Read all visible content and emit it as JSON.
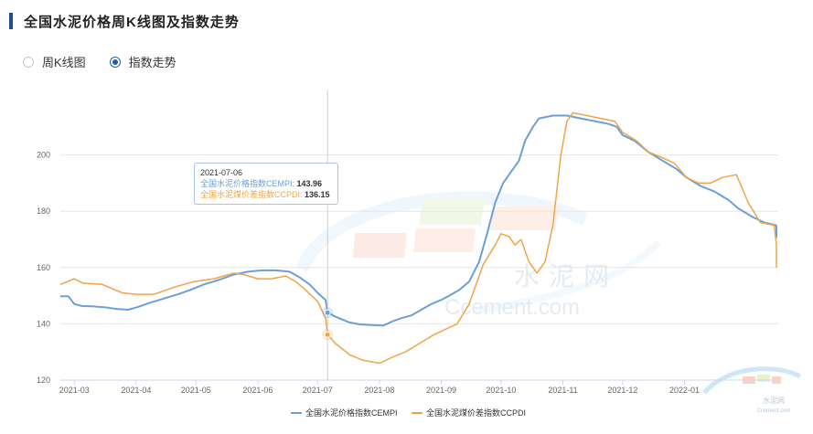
{
  "title": "全国水泥价格周K线图及指数走势",
  "tabs": [
    {
      "label": "周K线图",
      "selected": false
    },
    {
      "label": "指数走势",
      "selected": true
    }
  ],
  "colors": {
    "accent": "#1f4e8c",
    "cempi": "#6d9fd6",
    "ccpdi": "#f0a448"
  },
  "watermark": {
    "logo": "水泥网",
    "domain": "Ccement.com",
    "corner": "水泥网",
    "corner_domain": "Ccement.com"
  },
  "tooltip": {
    "date": "2021-07-06",
    "cempi_label": "全国水泥价格指数CEMPI:",
    "cempi_value": "143.96",
    "ccpdi_label": "全国水泥煤价差指数CCPDI:",
    "ccpdi_value": "136.15"
  },
  "chart_data": {
    "type": "line",
    "xlim": [
      "2021-02-22",
      "2022-02-17"
    ],
    "ylim": [
      120,
      220
    ],
    "yticks": [
      120,
      140,
      160,
      180,
      200
    ],
    "xticks": [
      "2021-03",
      "2021-04",
      "2021-05",
      "2021-06",
      "2021-07",
      "2021-08",
      "2021-09",
      "2021-10",
      "2021-11",
      "2021-12",
      "2022-01"
    ],
    "grid": "horizontal",
    "legend": "bottom-center",
    "highlight_date": "2021-07-06",
    "series": [
      {
        "name": "全国水泥价格指数CEMPI",
        "points": [
          [
            "2021-02-22",
            149.8
          ],
          [
            "2021-02-26",
            149.8
          ],
          [
            "2021-03-01",
            147
          ],
          [
            "2021-03-05",
            146.3
          ],
          [
            "2021-03-10",
            146.2
          ],
          [
            "2021-03-17",
            145.8
          ],
          [
            "2021-03-22",
            145.3
          ],
          [
            "2021-03-28",
            145
          ],
          [
            "2021-04-02",
            146
          ],
          [
            "2021-04-08",
            147.5
          ],
          [
            "2021-04-15",
            149
          ],
          [
            "2021-04-22",
            150.5
          ],
          [
            "2021-04-28",
            152
          ],
          [
            "2021-05-05",
            154
          ],
          [
            "2021-05-12",
            155.5
          ],
          [
            "2021-05-20",
            157.5
          ],
          [
            "2021-05-27",
            158.5
          ],
          [
            "2021-06-03",
            159
          ],
          [
            "2021-06-10",
            159
          ],
          [
            "2021-06-17",
            158.5
          ],
          [
            "2021-06-22",
            156.5
          ],
          [
            "2021-06-27",
            154
          ],
          [
            "2021-07-01",
            151
          ],
          [
            "2021-07-05",
            148.5
          ],
          [
            "2021-07-06",
            143.96
          ],
          [
            "2021-07-10",
            142.5
          ],
          [
            "2021-07-17",
            140.5
          ],
          [
            "2021-07-22",
            139.8
          ],
          [
            "2021-07-29",
            139.5
          ],
          [
            "2021-08-03",
            139.4
          ],
          [
            "2021-08-08",
            141
          ],
          [
            "2021-08-12",
            142
          ],
          [
            "2021-08-17",
            143
          ],
          [
            "2021-08-22",
            145
          ],
          [
            "2021-08-27",
            147
          ],
          [
            "2021-09-01",
            148.5
          ],
          [
            "2021-09-05",
            150
          ],
          [
            "2021-09-10",
            152
          ],
          [
            "2021-09-15",
            155
          ],
          [
            "2021-09-20",
            162
          ],
          [
            "2021-09-24",
            172
          ],
          [
            "2021-09-28",
            183
          ],
          [
            "2021-10-02",
            190
          ],
          [
            "2021-10-06",
            194
          ],
          [
            "2021-10-10",
            198
          ],
          [
            "2021-10-13",
            205
          ],
          [
            "2021-10-17",
            210
          ],
          [
            "2021-10-20",
            213
          ],
          [
            "2021-10-27",
            214
          ],
          [
            "2021-11-03",
            214
          ],
          [
            "2021-11-10",
            213
          ],
          [
            "2021-11-17",
            212
          ],
          [
            "2021-11-24",
            211
          ],
          [
            "2021-11-28",
            210
          ],
          [
            "2021-12-01",
            207
          ],
          [
            "2021-12-07",
            205
          ],
          [
            "2021-12-14",
            201
          ],
          [
            "2021-12-21",
            198
          ],
          [
            "2021-12-28",
            195
          ],
          [
            "2022-01-02",
            192
          ],
          [
            "2022-01-09",
            189
          ],
          [
            "2022-01-16",
            187
          ],
          [
            "2022-01-23",
            184
          ],
          [
            "2022-01-28",
            181
          ],
          [
            "2022-02-04",
            178
          ],
          [
            "2022-02-10",
            176
          ],
          [
            "2022-02-16",
            175
          ],
          [
            "2022-02-21",
            174
          ],
          [
            "2022-02-26",
            173
          ],
          [
            "2022-03-01",
            170.5
          ],
          [
            "2022-03-04",
            170.5
          ]
        ]
      },
      {
        "name": "全国水泥煤价差指数CCPDI",
        "points": [
          [
            "2021-02-22",
            154
          ],
          [
            "2021-03-01",
            156
          ],
          [
            "2021-03-05",
            154.5
          ],
          [
            "2021-03-15",
            154
          ],
          [
            "2021-03-25",
            151
          ],
          [
            "2021-04-01",
            150.5
          ],
          [
            "2021-04-10",
            150.5
          ],
          [
            "2021-04-20",
            153
          ],
          [
            "2021-04-30",
            155
          ],
          [
            "2021-05-10",
            156
          ],
          [
            "2021-05-20",
            158
          ],
          [
            "2021-05-25",
            157.5
          ],
          [
            "2021-06-01",
            156
          ],
          [
            "2021-06-08",
            156
          ],
          [
            "2021-06-15",
            157
          ],
          [
            "2021-06-20",
            155
          ],
          [
            "2021-06-25",
            152
          ],
          [
            "2021-07-01",
            148
          ],
          [
            "2021-07-05",
            142
          ],
          [
            "2021-07-06",
            136.15
          ],
          [
            "2021-07-10",
            133
          ],
          [
            "2021-07-17",
            129
          ],
          [
            "2021-07-24",
            127
          ],
          [
            "2021-08-01",
            126
          ],
          [
            "2021-08-07",
            128
          ],
          [
            "2021-08-14",
            130
          ],
          [
            "2021-08-21",
            133
          ],
          [
            "2021-08-28",
            136
          ],
          [
            "2021-09-03",
            138
          ],
          [
            "2021-09-09",
            140
          ],
          [
            "2021-09-15",
            147
          ],
          [
            "2021-09-22",
            161
          ],
          [
            "2021-09-28",
            168
          ],
          [
            "2021-10-01",
            172
          ],
          [
            "2021-10-05",
            171
          ],
          [
            "2021-10-08",
            168
          ],
          [
            "2021-10-11",
            170
          ],
          [
            "2021-10-15",
            162
          ],
          [
            "2021-10-19",
            158
          ],
          [
            "2021-10-23",
            162
          ],
          [
            "2021-10-27",
            175
          ],
          [
            "2021-10-31",
            200
          ],
          [
            "2021-11-03",
            212
          ],
          [
            "2021-11-06",
            215
          ],
          [
            "2021-11-13",
            214
          ],
          [
            "2021-11-20",
            213
          ],
          [
            "2021-11-27",
            212
          ],
          [
            "2021-12-01",
            208
          ],
          [
            "2021-12-08",
            205
          ],
          [
            "2021-12-14",
            201
          ],
          [
            "2021-12-21",
            199
          ],
          [
            "2021-12-27",
            197
          ],
          [
            "2022-01-02",
            192
          ],
          [
            "2022-01-08",
            190
          ],
          [
            "2022-01-14",
            190
          ],
          [
            "2022-01-20",
            192
          ],
          [
            "2022-01-27",
            193
          ],
          [
            "2022-02-02",
            183
          ],
          [
            "2022-02-08",
            176
          ],
          [
            "2022-02-15",
            175
          ],
          [
            "2022-02-20",
            168
          ],
          [
            "2022-02-26",
            166
          ],
          [
            "2022-03-01",
            162
          ],
          [
            "2022-03-04",
            160
          ]
        ]
      }
    ]
  }
}
